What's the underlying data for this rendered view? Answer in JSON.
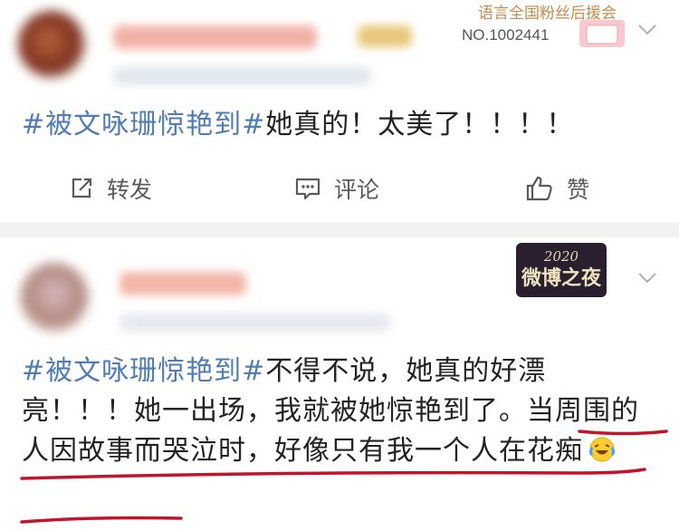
{
  "colors": {
    "hashtag": "#4f7db3",
    "text": "#222222",
    "action": "#5a5a5a",
    "annotation": "#c4142b",
    "background": "#f2f2f2"
  },
  "post1": {
    "badge_text_top": "语言全国粉丝后援会",
    "badge_text_bottom": "NO.1002441",
    "tag": "#被文咏珊惊艳到#",
    "text": "她真的！太美了！！！！",
    "actions": {
      "repost": "转发",
      "comment": "评论",
      "like": "赞"
    },
    "icons": {
      "repost": "share-box-icon",
      "comment": "comment-icon",
      "like": "thumbs-up-icon",
      "menu": "chevron-down-icon"
    }
  },
  "post2": {
    "badge_year": "2020",
    "badge_title": "微博之夜",
    "tag": "#被文咏珊惊艳到#",
    "text_a": "不得不说，她真的好漂亮！！！她一出场，我就被她惊艳到了。",
    "text_b": "当周围的人因故事而哭泣时，好像只有我一个人在花痴",
    "emoji": "laughing-crying-emoji",
    "icons": {
      "menu": "chevron-down-icon"
    }
  }
}
